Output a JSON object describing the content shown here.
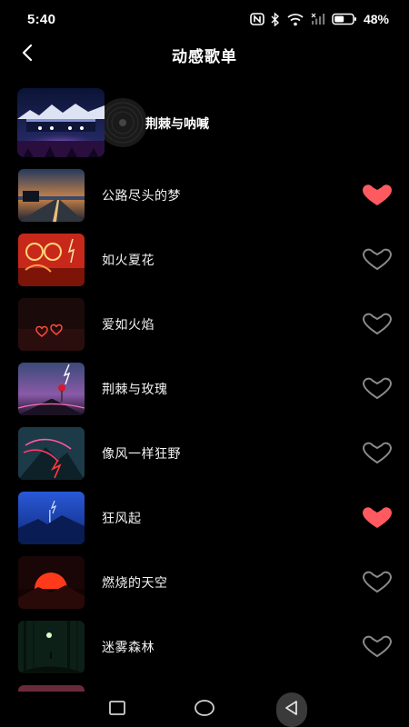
{
  "status_bar": {
    "time": "5:40",
    "battery": "48%"
  },
  "header": {
    "title": "动感歌单"
  },
  "now_playing": {
    "title": "荆棘与呐喊"
  },
  "songs": [
    {
      "title": "公路尽头的梦",
      "liked": true
    },
    {
      "title": "如火夏花",
      "liked": false
    },
    {
      "title": "爱如火焰",
      "liked": false
    },
    {
      "title": "荆棘与玫瑰",
      "liked": false
    },
    {
      "title": "像风一样狂野",
      "liked": false
    },
    {
      "title": "狂风起",
      "liked": true
    },
    {
      "title": "燃烧的天空",
      "liked": false
    },
    {
      "title": "迷雾森林",
      "liked": false
    }
  ],
  "icons": {
    "back": "chevron-left-icon",
    "heart_filled": "heart-filled-icon",
    "heart_outline": "heart-outline-icon",
    "nav_recent": "square-icon",
    "nav_home": "circle-icon",
    "nav_back": "triangle-left-icon"
  },
  "colors": {
    "liked_heart": "#ff5a5f",
    "unliked_heart": "#8a8a8a",
    "background": "#000000"
  }
}
